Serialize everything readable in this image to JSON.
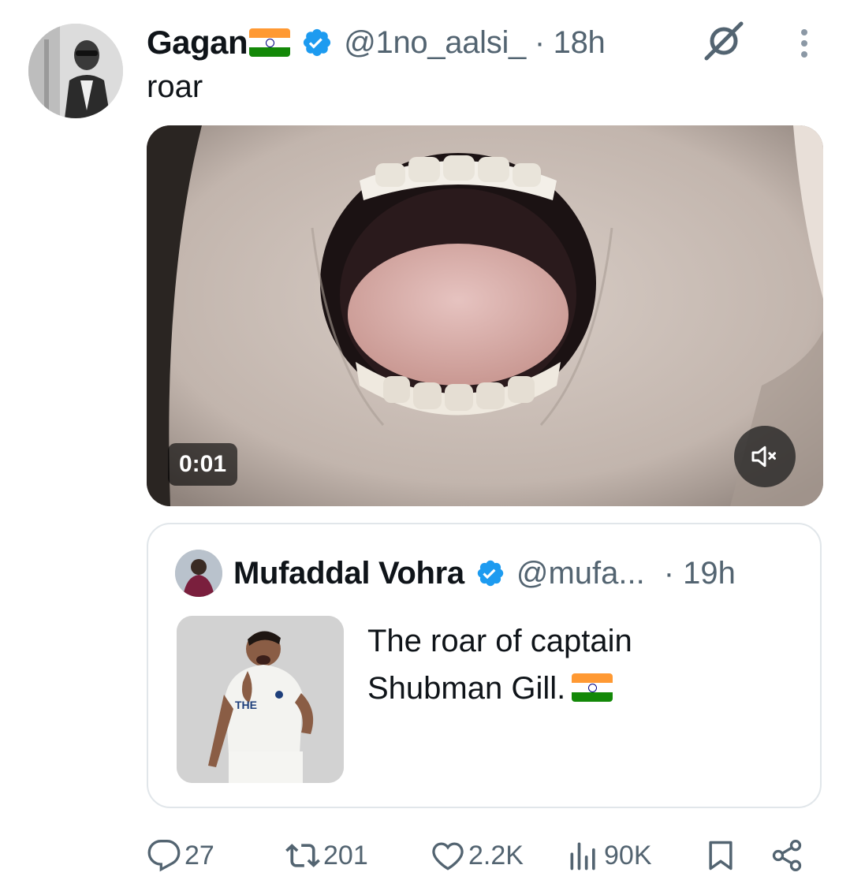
{
  "tweet": {
    "author_name": "Gagan",
    "handle_time": "@1no_aalsi_ · 18h",
    "text": "roar",
    "media": {
      "duration": "0:01"
    }
  },
  "quote": {
    "author_name": "Mufaddal Vohra",
    "handle": "@mufa...",
    "time": "· 19h",
    "text": "The roar of captain Shubman Gill."
  },
  "actions": {
    "replies": "27",
    "reposts": "201",
    "likes": "2.2K",
    "views": "90K"
  },
  "icons": {
    "verified": "verified-badge-icon",
    "grok": "grok-icon",
    "more": "more-vertical-icon",
    "mute": "volume-muted-icon",
    "reply": "reply-icon",
    "repost": "repost-icon",
    "like": "heart-icon",
    "views": "views-icon",
    "bookmark": "bookmark-icon",
    "share": "share-icon",
    "flag": "india-flag-icon"
  },
  "colors": {
    "text": "#0f1419",
    "secondary": "#536471",
    "verified": "#1d9bf0",
    "flag_saffron": "#ff9933",
    "flag_white": "#ffffff",
    "flag_green": "#138808",
    "flag_chakra": "#000080"
  }
}
